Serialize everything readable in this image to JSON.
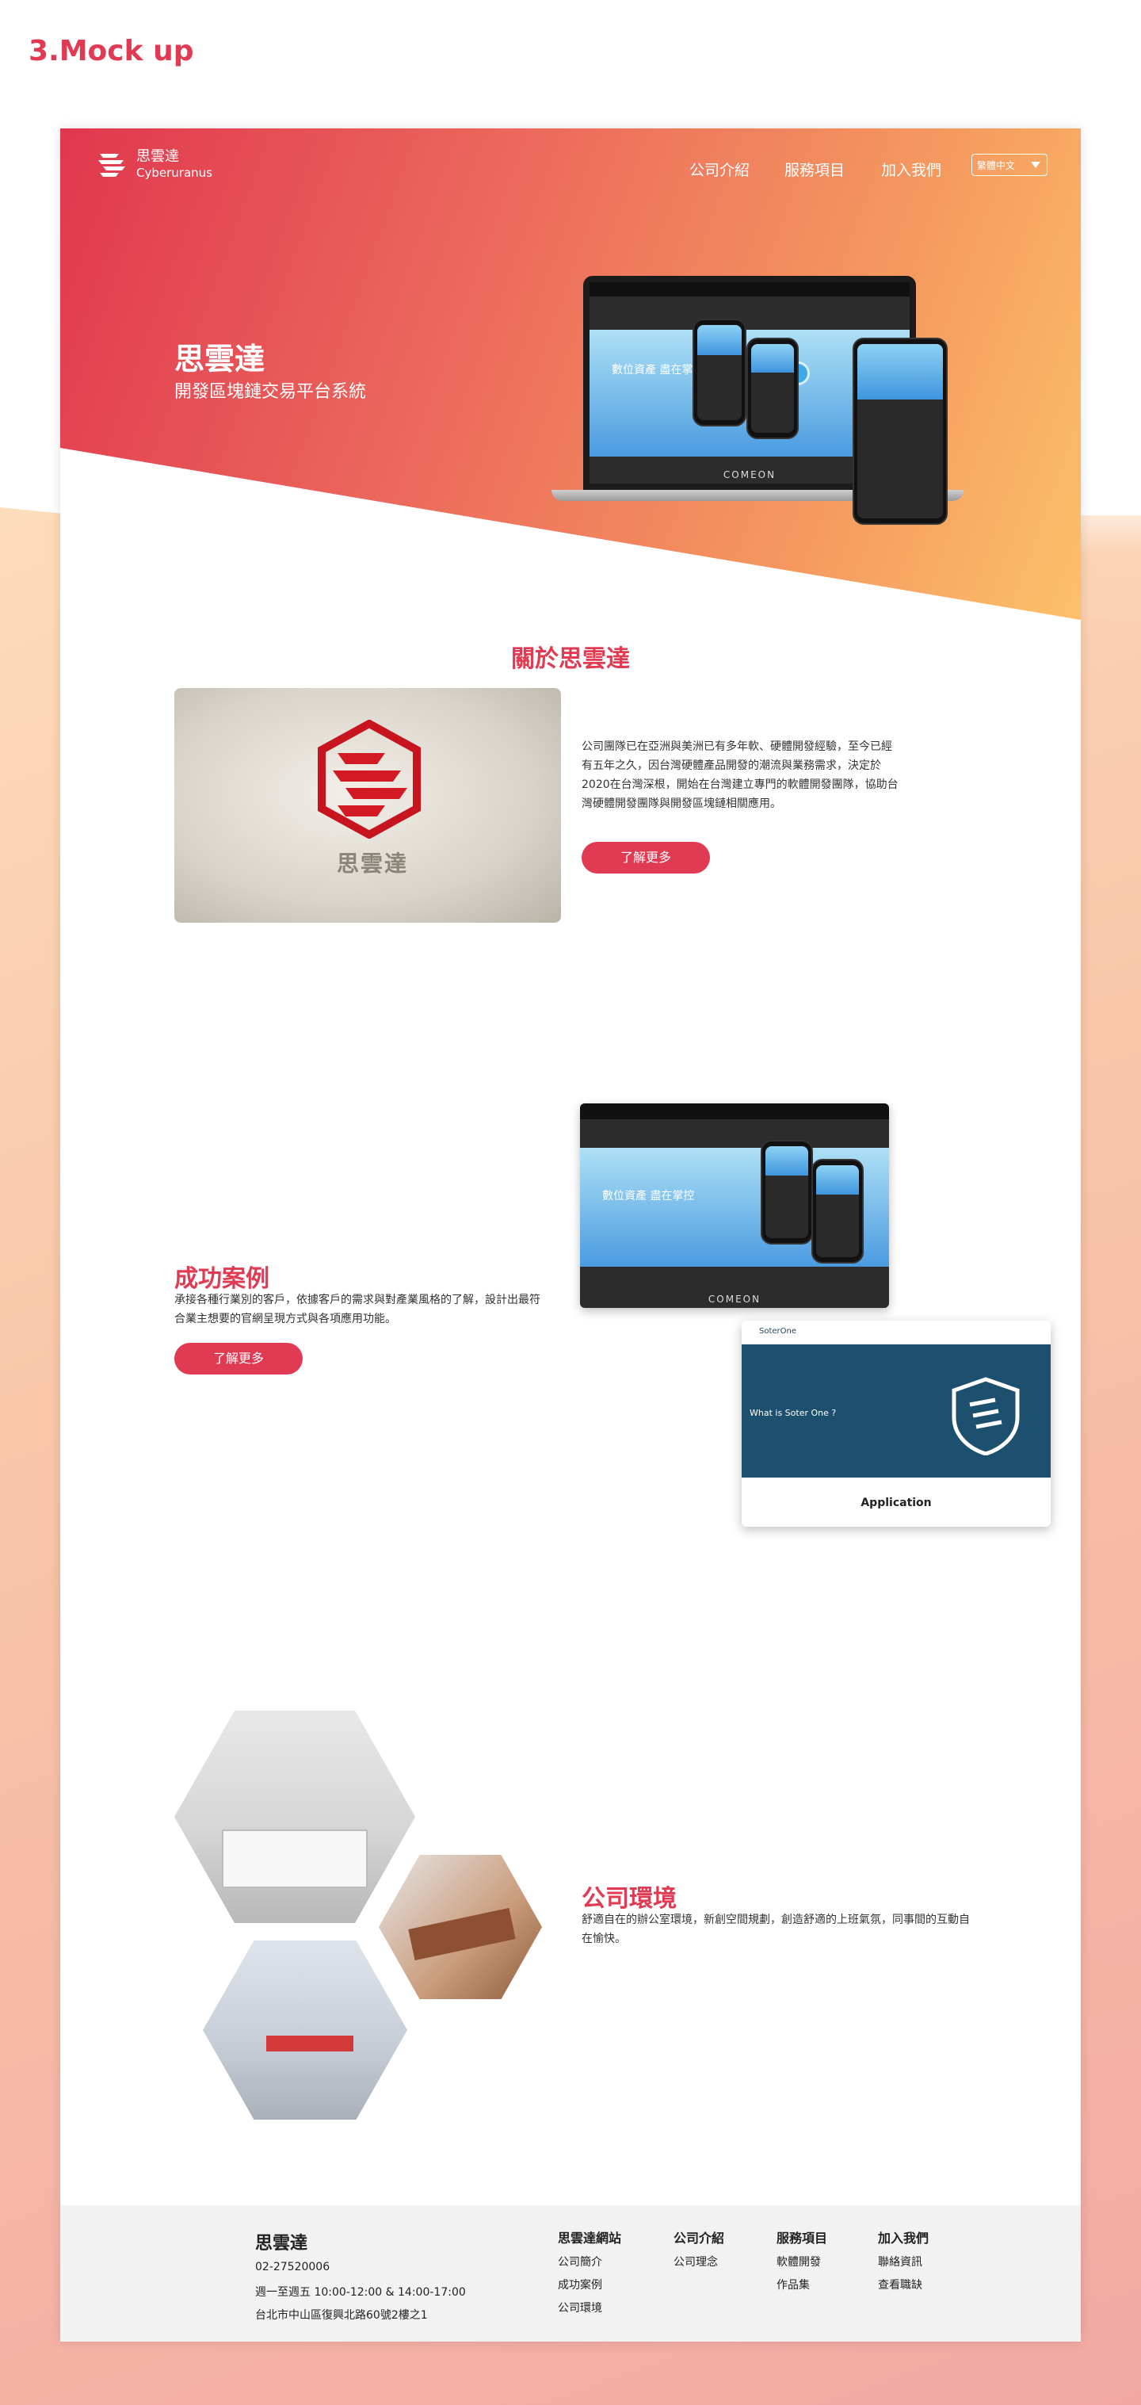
{
  "section_heading": "3.Mock up",
  "header": {
    "logo_cn": "思雲達",
    "logo_en": "Cyberuranus",
    "nav": [
      "公司介紹",
      "服務項目",
      "加入我們"
    ],
    "lang": "繁體中文"
  },
  "hero": {
    "title": "思雲達",
    "subtitle": "開發區塊鏈交易平台系統",
    "mock_banner_1": "數位資產 盡在掌控",
    "mock_footer": "COMEON"
  },
  "about": {
    "title": "關於思雲達",
    "sign_text": "思雲達",
    "text": "公司團隊已在亞洲與美洲已有多年軟、硬體開發經驗，至今已經有五年之久，因台灣硬體產品開發的潮流與業務需求，決定於2020在台灣深根，開始在台灣建立專門的軟體開發團隊，協助台灣硬體開發團隊與開發區塊鏈相關應用。",
    "button": "了解更多"
  },
  "cases": {
    "title": "成功案例",
    "text": "承接各種行業別的客戶，依據客戶的需求與對產業風格的了解，設計出最符合業主想要的官網呈現方式與各項應用功能。",
    "button": "了解更多",
    "shot1_banner": "數位資產 盡在掌控",
    "shot1_footer": "COMEON",
    "shot2_brand": "SoterOne",
    "shot2_heading": "What is Soter One ?",
    "shot2_section": "Application"
  },
  "environment": {
    "title": "公司環境",
    "text": "舒適自在的辦公室環境，新創空間規劃，創造舒適的上班氣氛，同事間的互動自在愉快。"
  },
  "footer": {
    "name": "思雲達",
    "phone": "02-27520006",
    "hours": "週一至週五 10:00-12:00 & 14:00-17:00",
    "address": "台北市中山區復興北路60號2樓之1",
    "columns": [
      {
        "heading": "思雲達網站",
        "items": [
          "公司簡介",
          "成功案例",
          "公司環境"
        ]
      },
      {
        "heading": "公司介紹",
        "items": [
          "公司理念"
        ]
      },
      {
        "heading": "服務項目",
        "items": [
          "軟體開發",
          "作品集"
        ]
      },
      {
        "heading": "加入我們",
        "items": [
          "聯絡資訊",
          "查看職缺"
        ]
      }
    ]
  },
  "colors": {
    "accent": "#e03b52",
    "hero_start": "#e0374f",
    "hero_end": "#fcc06a",
    "footer_bg": "#f2f2f2"
  }
}
